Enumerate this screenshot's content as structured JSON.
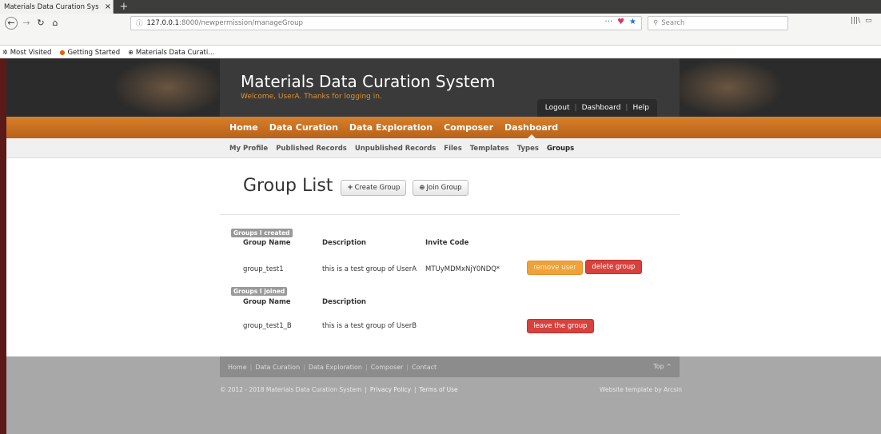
{
  "browser": {
    "tab_title": "Materials Data Curation Sys",
    "tab_close": "×",
    "new_tab": "+",
    "url_host": "127.0.0.1",
    "url_path": ":8000/newpermission/manageGroup",
    "search_placeholder": "Search",
    "bookmarks": [
      {
        "label": "Most Visited",
        "icon": "gear-icon"
      },
      {
        "label": "Getting Started",
        "icon": "firefox-icon"
      },
      {
        "label": "Materials Data Curati...",
        "icon": "globe-icon"
      }
    ]
  },
  "header": {
    "title": "Materials Data Curation System",
    "welcome": "Welcome, UserA. Thanks for logging in.",
    "links": [
      "Logout",
      "Dashboard",
      "Help"
    ]
  },
  "main_nav": [
    "Home",
    "Data Curation",
    "Data Exploration",
    "Composer",
    "Dashboard"
  ],
  "sub_nav": [
    "My Profile",
    "Published Records",
    "Unpublished Records",
    "Files",
    "Templates",
    "Types",
    "Groups"
  ],
  "content": {
    "heading": "Group List",
    "create_button": "Create Group",
    "join_button": "Join Group",
    "created_section": {
      "badge": "Groups I created",
      "columns": [
        "Group Name",
        "Description",
        "Invite Code"
      ],
      "rows": [
        {
          "name": "group_test1",
          "description": "this is a test group of UserA",
          "invite_code": "MTUyMDMxNjY0NDQ*",
          "actions": [
            "remove user",
            "delete group"
          ]
        }
      ]
    },
    "joined_section": {
      "badge": "Groups I joined",
      "columns": [
        "Group Name",
        "Description"
      ],
      "rows": [
        {
          "name": "group_test1_B",
          "description": "this is a test group of UserB",
          "actions": [
            "leave the group"
          ]
        }
      ]
    }
  },
  "footer": {
    "links": [
      "Home",
      "Data Curation",
      "Data Exploration",
      "Composer",
      "Contact"
    ],
    "top": "Top ^",
    "copyright": "© 2012 - 2018 Materials Data Curation System",
    "privacy": "Privacy Policy",
    "terms": "Terms of Use",
    "credit": "Website template by Arcsin"
  },
  "colors": {
    "accent_orange": "#d87f2a",
    "danger": "#d9413d",
    "warning": "#f0a238",
    "header_dark": "#2b2b2b"
  }
}
